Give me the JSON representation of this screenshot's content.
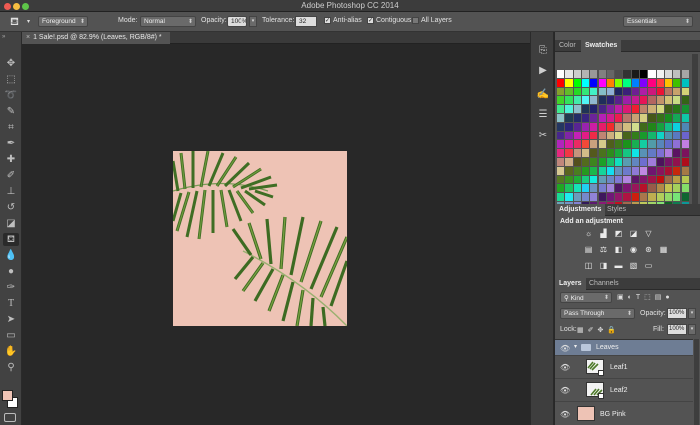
{
  "app": {
    "title": "Adobe Photoshop CC 2014"
  },
  "options_bar": {
    "tool_preset_icon": "paint-bucket-icon",
    "fill_source": "Foreground",
    "mode_label": "Mode:",
    "mode_value": "Normal",
    "opacity_label": "Opacity:",
    "opacity_value": "100%",
    "tolerance_label": "Tolerance:",
    "tolerance_value": "32",
    "anti_alias_label": "Anti-alias",
    "contiguous_label": "Contiguous",
    "all_layers_label": "All Layers",
    "workspace": "Essentials"
  },
  "document": {
    "tab_title": "1 Sale!.psd @ 82.9% (Leaves, RGB/8#) *"
  },
  "colors": {
    "foreground": "#eec3b5",
    "background": "#ffffff",
    "artwork_bg": "#eec3b5"
  },
  "color_panel": {
    "tabs": [
      "Color",
      "Swatches"
    ]
  },
  "adjustments_panel": {
    "tabs": [
      "Adjustments",
      "Styles"
    ],
    "heading": "Add an adjustment"
  },
  "layers_panel": {
    "tabs": [
      "Layers",
      "Channels"
    ],
    "filter": "Kind",
    "blend_mode": "Pass Through",
    "opacity_label": "Opacity:",
    "opacity_value": "100%",
    "lock_label": "Lock:",
    "fill_label": "Fill:",
    "fill_value": "100%",
    "layers": [
      {
        "name": "Leaves",
        "kind": "group"
      },
      {
        "name": "Leaf1",
        "kind": "smart-object"
      },
      {
        "name": "Leaf2",
        "kind": "smart-object"
      },
      {
        "name": "BG Pink",
        "kind": "layer"
      }
    ]
  },
  "tools": [
    "move-tool-icon",
    "marquee-tool-icon",
    "lasso-tool-icon",
    "quick-select-tool-icon",
    "crop-tool-icon",
    "eyedropper-tool-icon",
    "healing-brush-tool-icon",
    "brush-tool-icon",
    "clone-stamp-tool-icon",
    "history-brush-tool-icon",
    "eraser-tool-icon",
    "paint-bucket-tool-icon",
    "blur-tool-icon",
    "dodge-tool-icon",
    "pen-tool-icon",
    "type-tool-icon",
    "path-select-tool-icon",
    "shape-tool-icon",
    "hand-tool-icon",
    "zoom-tool-icon"
  ]
}
